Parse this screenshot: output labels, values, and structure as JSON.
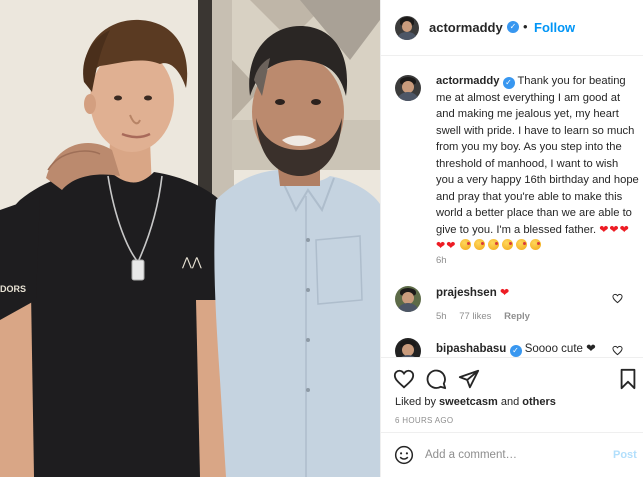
{
  "post": {
    "username": "actormaddy",
    "verified": true,
    "follow_label": "Follow",
    "dot": "•"
  },
  "photo": {
    "shirt_print_text": "DORS",
    "shirt_logo_text": "⋀⋀"
  },
  "caption": {
    "username": "actormaddy",
    "text": "Thank you for beating me at almost everything I am good at and making me jealous yet, my heart swell with pride. I have to learn so much from you my boy. As you step into the threshold of manhood, I want to wish you a very happy 16th birthday and hope and pray that you're able to make this world a better place than we are able to give to you. I'm a blessed father.",
    "trailing_hearts": "❤❤❤",
    "second_line_hearts": "❤❤",
    "emoji_count": 6,
    "time": "6h"
  },
  "comments": [
    {
      "username": "prajeshsen",
      "text": "❤",
      "time": "5h",
      "likes": "77 likes",
      "reply_label": "Reply"
    },
    {
      "username": "bipashabasu",
      "verified": true,
      "text": "Soooo cute ❤"
    }
  ],
  "footer": {
    "liked_by_prefix": "Liked by",
    "liked_by_user": "sweetcasm",
    "liked_by_suffix": "and",
    "liked_by_others": "others",
    "timestamp": "6 HOURS AGO",
    "add_comment_placeholder": "Add a comment…",
    "post_label": "Post"
  },
  "icons": {
    "like": "heart-outline-icon",
    "comment": "speech-bubble-icon",
    "share": "paper-plane-icon",
    "save": "bookmark-icon",
    "emoji": "smiley-icon"
  },
  "colors": {
    "link_blue": "#0095f6",
    "verified_blue": "#3897f0",
    "heart_red": "#ed1c24",
    "muted": "#8e8e8e",
    "post_disabled": "#b2dffc"
  }
}
